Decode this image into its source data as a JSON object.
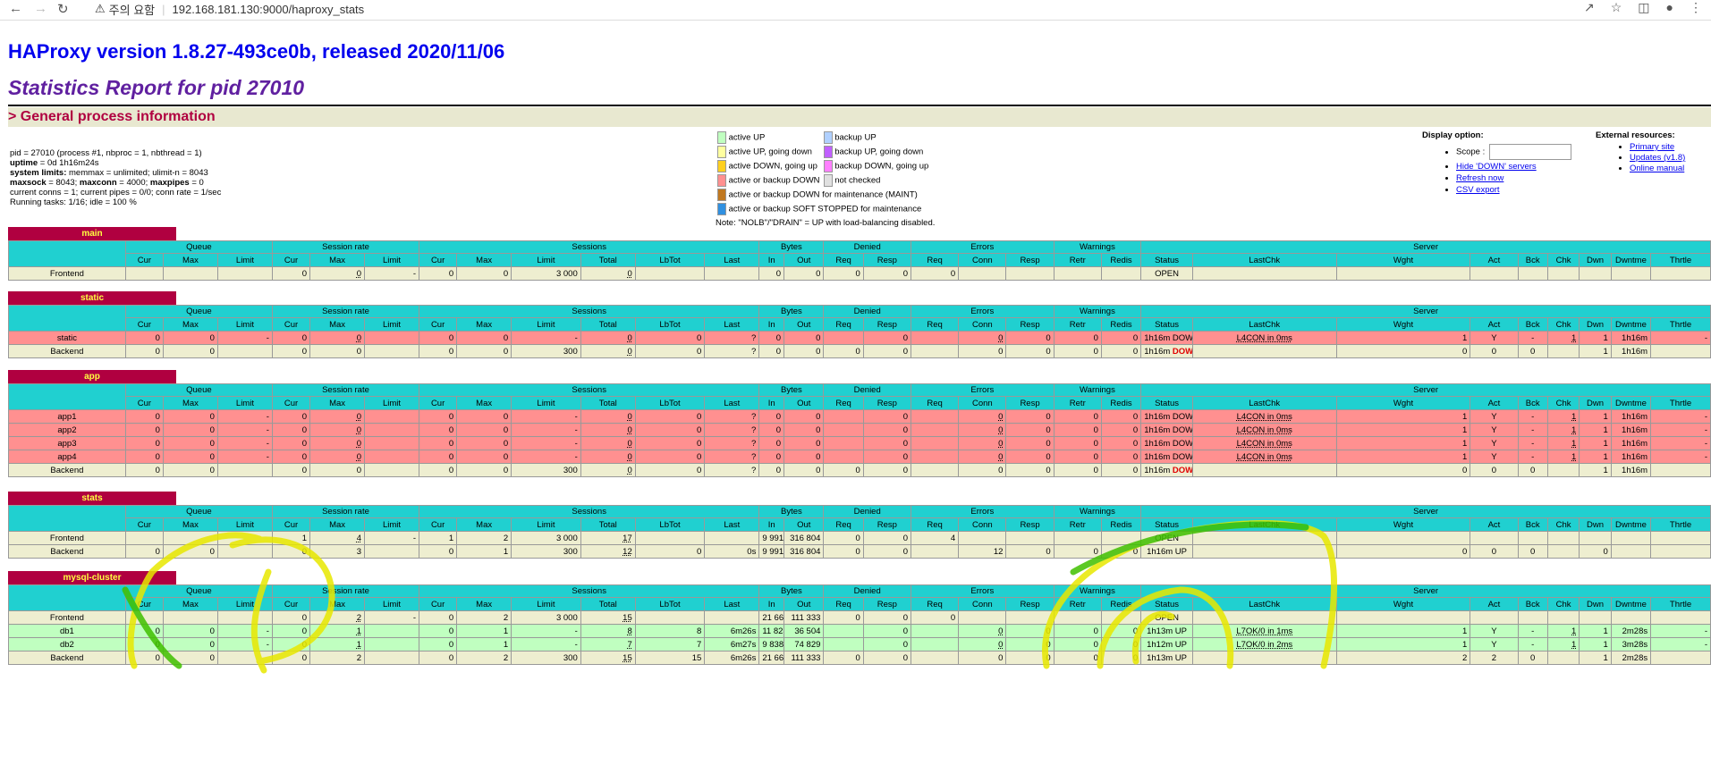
{
  "browser": {
    "security_label": "주의 요함",
    "url": "192.168.181.130:9000/haproxy_stats"
  },
  "header": {
    "version": "HAProxy version 1.8.27-493ce0b, released 2020/11/06",
    "report_title": "Statistics Report for pid 27010",
    "general_section": "> General process information"
  },
  "process_info": {
    "line1": "pid = 27010 (process #1, nbproc = 1, nbthread = 1)",
    "uptime_label": "uptime",
    "uptime_value": " = 0d 1h16m24s",
    "limits_label": "system limits:",
    "limits_value": " memmax = unlimited; ulimit-n = 8043",
    "maxsock_label": "maxsock",
    "maxsock_value": " = 8043; ",
    "maxconn_label": "maxconn",
    "maxconn_value": " = 4000; ",
    "maxpipes_label": "maxpipes",
    "maxpipes_value": " = 0",
    "line5": "current conns = 1; current pipes = 0/0; conn rate = 1/sec",
    "line6": "Running tasks: 1/16; idle = 100 %"
  },
  "legend": {
    "items_left": [
      {
        "color": "#c0ffc0",
        "label": "active UP"
      },
      {
        "color": "#ffffa0",
        "label": "active UP, going down"
      },
      {
        "color": "#ffd020",
        "label": "active DOWN, going up"
      },
      {
        "color": "#ff9090",
        "label": "active or backup DOWN"
      },
      {
        "color": "#c07820",
        "label": "active or backup DOWN for maintenance (MAINT)"
      },
      {
        "color": "#3090e0",
        "label": "active or backup SOFT STOPPED for maintenance"
      }
    ],
    "items_right": [
      {
        "color": "#b0d0ff",
        "label": "backup UP"
      },
      {
        "color": "#c060ff",
        "label": "backup UP, going down"
      },
      {
        "color": "#ff80ff",
        "label": "backup DOWN, going up"
      },
      {
        "color": "#e0e0e0",
        "label": "not checked"
      }
    ],
    "note": "Note: \"NOLB\"/\"DRAIN\" = UP with load-balancing disabled."
  },
  "display_option": {
    "title": "Display option:",
    "scope_label": "Scope :",
    "links": [
      "Hide 'DOWN' servers",
      "Refresh now",
      "CSV export"
    ]
  },
  "external_resources": {
    "title": "External resources:",
    "links": [
      "Primary site",
      "Updates (v1.8)",
      "Online manual"
    ]
  },
  "columns": {
    "groups": [
      "Queue",
      "Session rate",
      "Sessions",
      "Bytes",
      "Denied",
      "Errors",
      "Warnings",
      "Server"
    ],
    "sub": [
      "Cur",
      "Max",
      "Limit",
      "Cur",
      "Max",
      "Limit",
      "Cur",
      "Max",
      "Limit",
      "Total",
      "LbTot",
      "Last",
      "In",
      "Out",
      "Req",
      "Resp",
      "Req",
      "Conn",
      "Resp",
      "Retr",
      "Redis",
      "Status",
      "LastChk",
      "Wght",
      "Act",
      "Bck",
      "Chk",
      "Dwn",
      "Dwntme",
      "Thrtle"
    ]
  },
  "proxies": [
    {
      "name": "main",
      "rows": [
        {
          "type": "front",
          "cells": [
            "Frontend",
            "",
            "",
            "",
            "0",
            "0",
            "-",
            "0",
            "0",
            "3 000",
            "0",
            "",
            "",
            "0",
            "0",
            "0",
            "0",
            "0",
            "",
            "",
            "",
            "",
            "OPEN",
            "",
            "",
            "",
            "",
            "",
            "",
            "",
            ""
          ]
        }
      ]
    },
    {
      "name": "static",
      "rows": [
        {
          "type": "down",
          "cells": [
            "static",
            "0",
            "0",
            "-",
            "0",
            "0",
            "",
            "0",
            "0",
            "-",
            "0",
            "0",
            "?",
            "0",
            "0",
            "",
            "0",
            "",
            "0",
            "0",
            "0",
            "0",
            "1h16m DOWN",
            "L4CON in 0ms",
            "1",
            "Y",
            "-",
            "1",
            "1",
            "1h16m",
            "-"
          ]
        },
        {
          "type": "back",
          "cells": [
            "Backend",
            "0",
            "0",
            "",
            "0",
            "0",
            "",
            "0",
            "0",
            "300",
            "0",
            "0",
            "?",
            "0",
            "0",
            "0",
            "0",
            "",
            "0",
            "0",
            "0",
            "0",
            "1h16m DOWN",
            "",
            "0",
            "0",
            "0",
            "",
            "1",
            "1h16m",
            ""
          ]
        }
      ]
    },
    {
      "name": "app",
      "rows": [
        {
          "type": "down",
          "cells": [
            "app1",
            "0",
            "0",
            "-",
            "0",
            "0",
            "",
            "0",
            "0",
            "-",
            "0",
            "0",
            "?",
            "0",
            "0",
            "",
            "0",
            "",
            "0",
            "0",
            "0",
            "0",
            "1h16m DOWN",
            "L4CON in 0ms",
            "1",
            "Y",
            "-",
            "1",
            "1",
            "1h16m",
            "-"
          ]
        },
        {
          "type": "down",
          "cells": [
            "app2",
            "0",
            "0",
            "-",
            "0",
            "0",
            "",
            "0",
            "0",
            "-",
            "0",
            "0",
            "?",
            "0",
            "0",
            "",
            "0",
            "",
            "0",
            "0",
            "0",
            "0",
            "1h16m DOWN",
            "L4CON in 0ms",
            "1",
            "Y",
            "-",
            "1",
            "1",
            "1h16m",
            "-"
          ]
        },
        {
          "type": "down",
          "cells": [
            "app3",
            "0",
            "0",
            "-",
            "0",
            "0",
            "",
            "0",
            "0",
            "-",
            "0",
            "0",
            "?",
            "0",
            "0",
            "",
            "0",
            "",
            "0",
            "0",
            "0",
            "0",
            "1h16m DOWN",
            "L4CON in 0ms",
            "1",
            "Y",
            "-",
            "1",
            "1",
            "1h16m",
            "-"
          ]
        },
        {
          "type": "down",
          "cells": [
            "app4",
            "0",
            "0",
            "-",
            "0",
            "0",
            "",
            "0",
            "0",
            "-",
            "0",
            "0",
            "?",
            "0",
            "0",
            "",
            "0",
            "",
            "0",
            "0",
            "0",
            "0",
            "1h16m DOWN",
            "L4CON in 0ms",
            "1",
            "Y",
            "-",
            "1",
            "1",
            "1h16m",
            "-"
          ]
        },
        {
          "type": "back",
          "cells": [
            "Backend",
            "0",
            "0",
            "",
            "0",
            "0",
            "",
            "0",
            "0",
            "300",
            "0",
            "0",
            "?",
            "0",
            "0",
            "0",
            "0",
            "",
            "0",
            "0",
            "0",
            "0",
            "1h16m DOWN",
            "",
            "0",
            "0",
            "0",
            "",
            "1",
            "1h16m",
            ""
          ]
        }
      ]
    },
    {
      "name": "stats",
      "rows": [
        {
          "type": "front",
          "cells": [
            "Frontend",
            "",
            "",
            "",
            "1",
            "4",
            "-",
            "1",
            "2",
            "3 000",
            "17",
            "",
            "",
            "9 991",
            "316 804",
            "0",
            "0",
            "4",
            "",
            "",
            "",
            "",
            "OPEN",
            "",
            "",
            "",
            "",
            "",
            "",
            "",
            ""
          ]
        },
        {
          "type": "back",
          "cells": [
            "Backend",
            "0",
            "0",
            "",
            "0",
            "3",
            "",
            "0",
            "1",
            "300",
            "12",
            "0",
            "0s",
            "9 991",
            "316 804",
            "0",
            "0",
            "",
            "12",
            "0",
            "0",
            "0",
            "1h16m UP",
            "",
            "0",
            "0",
            "0",
            "",
            "0",
            "",
            ""
          ]
        }
      ]
    },
    {
      "name": "mysql-cluster",
      "rows": [
        {
          "type": "front",
          "cells": [
            "Frontend",
            "",
            "",
            "",
            "0",
            "2",
            "-",
            "0",
            "2",
            "3 000",
            "15",
            "",
            "",
            "21 661",
            "111 333",
            "0",
            "0",
            "0",
            "",
            "",
            "",
            "",
            "OPEN",
            "",
            "",
            "",
            "",
            "",
            "",
            "",
            ""
          ]
        },
        {
          "type": "up",
          "cells": [
            "db1",
            "0",
            "0",
            "-",
            "0",
            "1",
            "",
            "0",
            "1",
            "-",
            "8",
            "8",
            "6m26s",
            "11 823",
            "36 504",
            "",
            "0",
            "",
            "0",
            "0",
            "0",
            "0",
            "1h13m UP",
            "L7OK/0 in 1ms",
            "1",
            "Y",
            "-",
            "1",
            "1",
            "2m28s",
            "-"
          ]
        },
        {
          "type": "up",
          "cells": [
            "db2",
            "0",
            "0",
            "-",
            "0",
            "1",
            "",
            "0",
            "1",
            "-",
            "7",
            "7",
            "6m27s",
            "9 838",
            "74 829",
            "",
            "0",
            "",
            "0",
            "0",
            "0",
            "0",
            "1h12m UP",
            "L7OK/0 in 2ms",
            "1",
            "Y",
            "-",
            "1",
            "1",
            "3m28s",
            "-"
          ]
        },
        {
          "type": "back",
          "cells": [
            "Backend",
            "0",
            "0",
            "",
            "0",
            "2",
            "",
            "0",
            "2",
            "300",
            "15",
            "15",
            "6m26s",
            "21 661",
            "111 333",
            "0",
            "0",
            "",
            "0",
            "0",
            "0",
            "0",
            "1h13m UP",
            "",
            "2",
            "2",
            "0",
            "",
            "1",
            "2m28s",
            ""
          ]
        }
      ]
    }
  ]
}
